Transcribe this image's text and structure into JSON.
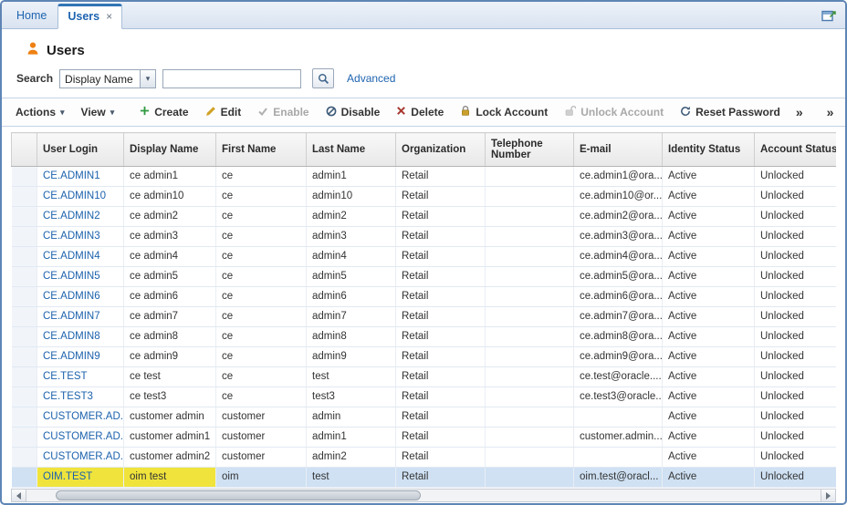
{
  "ui": {
    "caret": "▾",
    "chevron": "»",
    "close_symbol": "×"
  },
  "window": {
    "tabs": [
      {
        "label": "Home",
        "active": false
      },
      {
        "label": "Users",
        "active": true,
        "closable": true
      }
    ],
    "new_window_icon": "new-window-icon"
  },
  "page": {
    "title": "Users",
    "title_icon": "user-icon"
  },
  "search": {
    "label": "Search",
    "field_selector": "Display Name",
    "input_value": "",
    "search_icon": "magnifier-icon",
    "advanced_label": "Advanced"
  },
  "toolbar": {
    "actions_label": "Actions",
    "view_label": "View",
    "buttons": [
      {
        "label": "Create",
        "icon": "plus-icon",
        "enabled": true
      },
      {
        "label": "Edit",
        "icon": "pencil-icon",
        "enabled": true
      },
      {
        "label": "Enable",
        "icon": "check-icon",
        "enabled": false
      },
      {
        "label": "Disable",
        "icon": "circle-slash-icon",
        "enabled": true
      },
      {
        "label": "Delete",
        "icon": "x-icon",
        "enabled": true
      },
      {
        "label": "Lock Account",
        "icon": "lock-icon",
        "enabled": true
      },
      {
        "label": "Unlock Account",
        "icon": "unlock-icon",
        "enabled": false
      },
      {
        "label": "Reset Password",
        "icon": "reset-icon",
        "enabled": true
      }
    ],
    "overflow_chevron": "»",
    "secondary_chevron": "»"
  },
  "table": {
    "columns": [
      "User Login",
      "Display Name",
      "First Name",
      "Last Name",
      "Organization",
      "Telephone Number",
      "E-mail",
      "Identity Status",
      "Account Status"
    ],
    "rows": [
      {
        "user_login": "CE.ADMIN1",
        "display_name": "ce admin1",
        "first_name": "ce",
        "last_name": "admin1",
        "organization": "Retail",
        "telephone": "",
        "email": "ce.admin1@ora...",
        "identity_status": "Active",
        "account_status": "Unlocked"
      },
      {
        "user_login": "CE.ADMIN10",
        "display_name": "ce admin10",
        "first_name": "ce",
        "last_name": "admin10",
        "organization": "Retail",
        "telephone": "",
        "email": "ce.admin10@or...",
        "identity_status": "Active",
        "account_status": "Unlocked"
      },
      {
        "user_login": "CE.ADMIN2",
        "display_name": "ce admin2",
        "first_name": "ce",
        "last_name": "admin2",
        "organization": "Retail",
        "telephone": "",
        "email": "ce.admin2@ora...",
        "identity_status": "Active",
        "account_status": "Unlocked"
      },
      {
        "user_login": "CE.ADMIN3",
        "display_name": "ce admin3",
        "first_name": "ce",
        "last_name": "admin3",
        "organization": "Retail",
        "telephone": "",
        "email": "ce.admin3@ora...",
        "identity_status": "Active",
        "account_status": "Unlocked"
      },
      {
        "user_login": "CE.ADMIN4",
        "display_name": "ce admin4",
        "first_name": "ce",
        "last_name": "admin4",
        "organization": "Retail",
        "telephone": "",
        "email": "ce.admin4@ora...",
        "identity_status": "Active",
        "account_status": "Unlocked"
      },
      {
        "user_login": "CE.ADMIN5",
        "display_name": "ce admin5",
        "first_name": "ce",
        "last_name": "admin5",
        "organization": "Retail",
        "telephone": "",
        "email": "ce.admin5@ora...",
        "identity_status": "Active",
        "account_status": "Unlocked"
      },
      {
        "user_login": "CE.ADMIN6",
        "display_name": "ce admin6",
        "first_name": "ce",
        "last_name": "admin6",
        "organization": "Retail",
        "telephone": "",
        "email": "ce.admin6@ora...",
        "identity_status": "Active",
        "account_status": "Unlocked"
      },
      {
        "user_login": "CE.ADMIN7",
        "display_name": "ce admin7",
        "first_name": "ce",
        "last_name": "admin7",
        "organization": "Retail",
        "telephone": "",
        "email": "ce.admin7@ora...",
        "identity_status": "Active",
        "account_status": "Unlocked"
      },
      {
        "user_login": "CE.ADMIN8",
        "display_name": "ce admin8",
        "first_name": "ce",
        "last_name": "admin8",
        "organization": "Retail",
        "telephone": "",
        "email": "ce.admin8@ora...",
        "identity_status": "Active",
        "account_status": "Unlocked"
      },
      {
        "user_login": "CE.ADMIN9",
        "display_name": "ce admin9",
        "first_name": "ce",
        "last_name": "admin9",
        "organization": "Retail",
        "telephone": "",
        "email": "ce.admin9@ora...",
        "identity_status": "Active",
        "account_status": "Unlocked"
      },
      {
        "user_login": "CE.TEST",
        "display_name": "ce test",
        "first_name": "ce",
        "last_name": "test",
        "organization": "Retail",
        "telephone": "",
        "email": "ce.test@oracle....",
        "identity_status": "Active",
        "account_status": "Unlocked"
      },
      {
        "user_login": "CE.TEST3",
        "display_name": "ce test3",
        "first_name": "ce",
        "last_name": "test3",
        "organization": "Retail",
        "telephone": "",
        "email": "ce.test3@oracle...",
        "identity_status": "Active",
        "account_status": "Unlocked"
      },
      {
        "user_login": "CUSTOMER.AD...",
        "display_name": "customer admin",
        "first_name": "customer",
        "last_name": "admin",
        "organization": "Retail",
        "telephone": "",
        "email": "",
        "identity_status": "Active",
        "account_status": "Unlocked"
      },
      {
        "user_login": "CUSTOMER.AD...",
        "display_name": "customer admin1",
        "first_name": "customer",
        "last_name": "admin1",
        "organization": "Retail",
        "telephone": "",
        "email": "customer.admin...",
        "identity_status": "Active",
        "account_status": "Unlocked"
      },
      {
        "user_login": "CUSTOMER.AD...",
        "display_name": "customer admin2",
        "first_name": "customer",
        "last_name": "admin2",
        "organization": "Retail",
        "telephone": "",
        "email": "",
        "identity_status": "Active",
        "account_status": "Unlocked"
      },
      {
        "user_login": "OIM.TEST",
        "display_name": "oim test",
        "first_name": "oim",
        "last_name": "test",
        "organization": "Retail",
        "telephone": "",
        "email": "oim.test@oracl...",
        "identity_status": "Active",
        "account_status": "Unlocked",
        "selected": true,
        "highlight": [
          "user_login",
          "display_name"
        ]
      }
    ]
  },
  "colors": {
    "accent_blue": "#1e64b0",
    "selected_row": "#cfe1f3",
    "highlight_yellow": "#f0e43c",
    "frame_border": "#5e85b4"
  }
}
